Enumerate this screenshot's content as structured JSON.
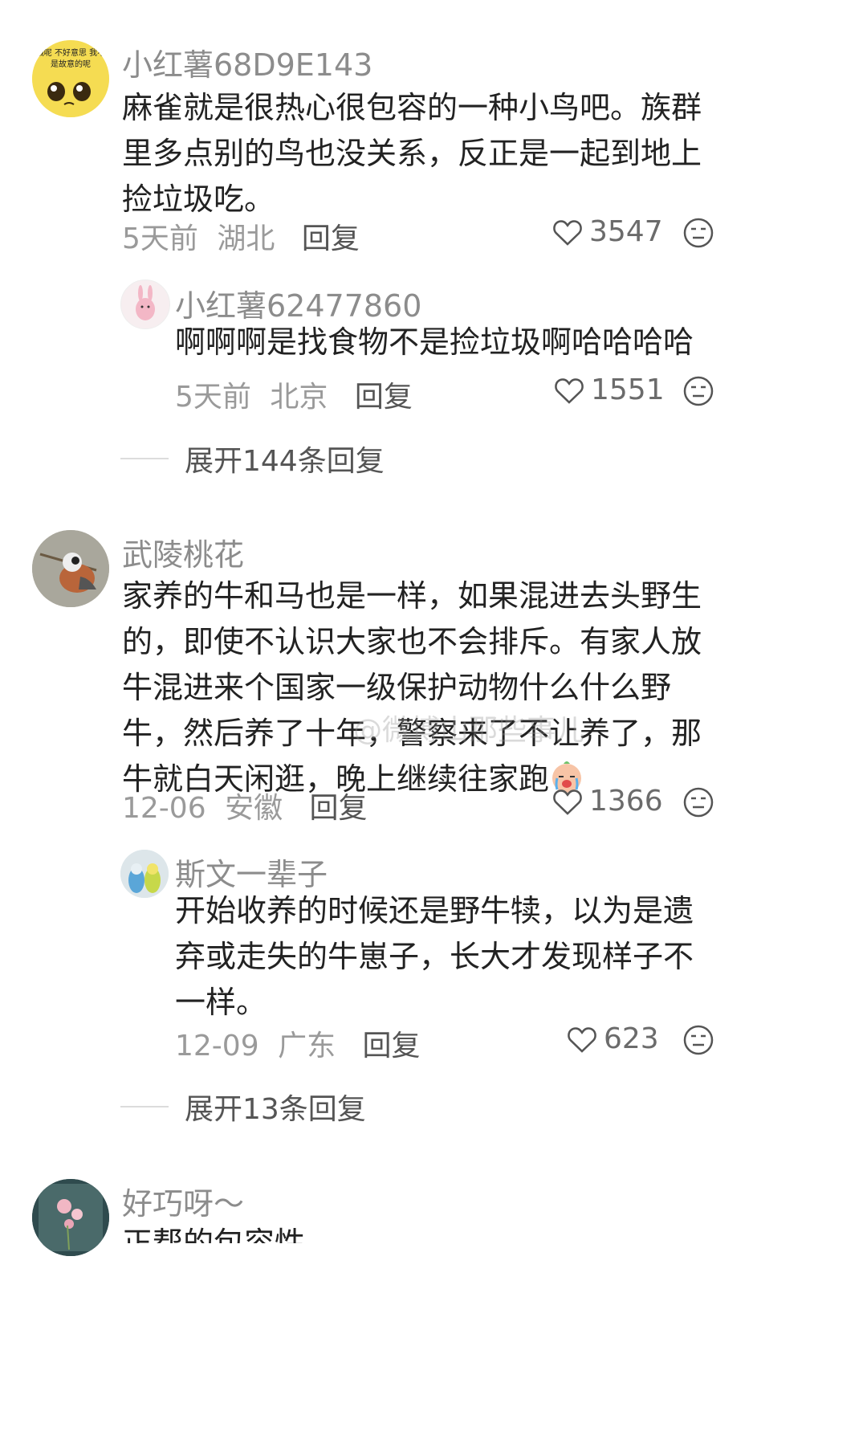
{
  "comments": [
    {
      "user": "小红薯68D9E143",
      "avatar_caption": "哦呢 不好意思 我不是故意的呢",
      "text": "麻雀就是很热心很包容的一种小鸟吧。族群里多点别的鸟也没关系，反正是一起到地上捡垃圾吃。",
      "time": "5天前",
      "location": "湖北",
      "reply_label": "回复",
      "likes": "3547",
      "replies": [
        {
          "user": "小红薯62477860",
          "text": "啊啊啊是找食物不是捡垃圾啊哈哈哈哈",
          "time": "5天前",
          "location": "北京",
          "reply_label": "回复",
          "likes": "1551"
        }
      ],
      "expand_label": "展开144条回复"
    },
    {
      "user": "武陵桃花",
      "text": "家养的牛和马也是一样，如果混进去头野生的，即使不认识大家也不会排斥。有家人放牛混进来个国家一级保护动物什么什么野牛，然后养了十年，警察来了不让养了，那牛就白天闲逛，晚上继续往家跑",
      "time": "12-06",
      "location": "安徽",
      "reply_label": "回复",
      "likes": "1366",
      "replies": [
        {
          "user": "斯文一辈子",
          "text": "开始收养的时候还是野牛犊，以为是遗弃或走失的牛崽子，长大才发现样子不一样。",
          "time": "12-09",
          "location": "广东",
          "reply_label": "回复",
          "likes": "623"
        }
      ],
      "expand_label": "展开13条回复"
    },
    {
      "user": "好巧呀～",
      "text": "正帮的包容性"
    }
  ],
  "watermark": "@微博山那些事儿",
  "colors": {
    "name": "#8c8c8c",
    "text": "#222222",
    "meta": "#9a9a9a"
  },
  "icons": [
    "heart-icon",
    "dislike-face-icon",
    "crying-emoji"
  ]
}
